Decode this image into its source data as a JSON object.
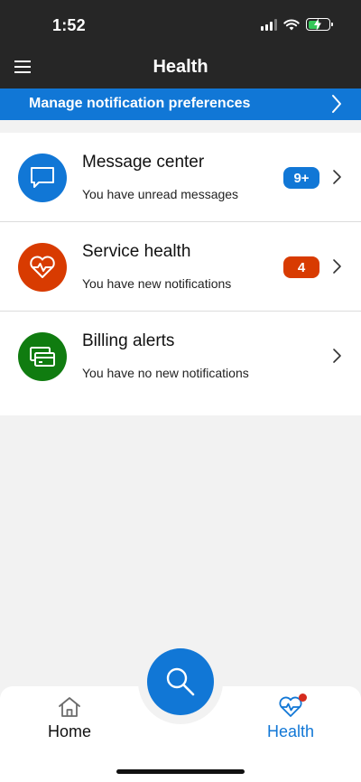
{
  "status_bar": {
    "time": "1:52"
  },
  "header": {
    "title": "Health"
  },
  "banner": {
    "label": "Manage notification preferences"
  },
  "cards": [
    {
      "title": "Message center",
      "subtitle": "You have unread messages",
      "badge": "9+",
      "icon": "message-icon",
      "color": "#1177d6"
    },
    {
      "title": "Service health",
      "subtitle": "You have new notifications",
      "badge": "4",
      "icon": "heart-pulse-icon",
      "color": "#d83b01"
    },
    {
      "title": "Billing alerts",
      "subtitle": "You have no new notifications",
      "badge": "",
      "icon": "billing-card-icon",
      "color": "#107c10"
    }
  ],
  "tabs": [
    {
      "label": "Home",
      "icon": "home-icon",
      "active": false
    },
    {
      "label": "Health",
      "icon": "heart-pulse-icon",
      "active": true
    }
  ],
  "colors": {
    "accent": "#1177d6",
    "dark_bar": "#262626"
  }
}
